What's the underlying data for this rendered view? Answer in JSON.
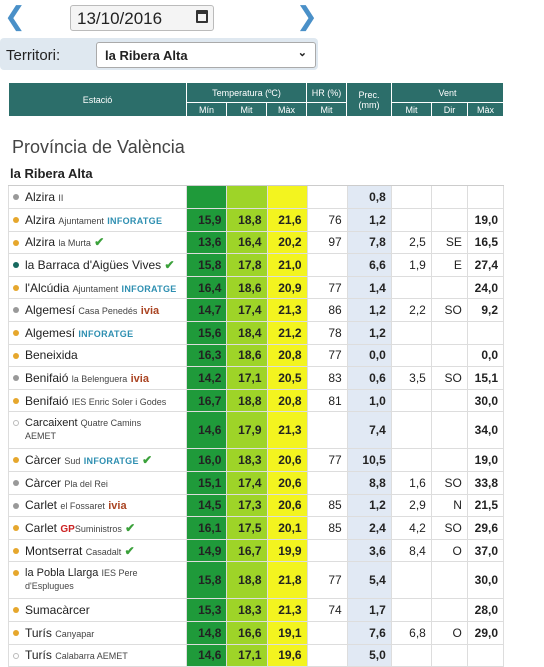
{
  "nav": {
    "prev": "❮",
    "next": "❯",
    "date": "13/10/2016"
  },
  "territori": {
    "label": "Territori:",
    "value": "la Ribera Alta"
  },
  "header": {
    "estacio": "Estació",
    "temperatura": "Temperatura (ºC)",
    "hr": "HR (%)",
    "prec": "Prec. (mm)",
    "vent": "Vent",
    "min": "Mín",
    "mit": "Mit",
    "max": "Màx",
    "hr_mit": "Mit",
    "v_mit": "Mit",
    "v_dir": "Dir",
    "v_max": "Màx"
  },
  "province": "Província de València",
  "region": "la Ribera Alta",
  "rows": [
    {
      "name": "Alzira",
      "sub": "II",
      "dot": "grey",
      "min": "",
      "mit": "",
      "max": "",
      "hr": "",
      "prec": "0,8",
      "vmit": "",
      "vdir": "",
      "vmax": ""
    },
    {
      "name": "Alzira",
      "sub": "Ajuntament",
      "brand": "INFORATGE",
      "dot": "orange",
      "min": "15,9",
      "mit": "18,8",
      "max": "21,6",
      "hr": "76",
      "prec": "1,2",
      "vmit": "",
      "vdir": "",
      "vmax": "19,0"
    },
    {
      "name": "Alzira",
      "sub": "la Murta",
      "tick": "✔",
      "dot": "orange",
      "min": "13,6",
      "mit": "16,4",
      "max": "20,2",
      "hr": "97",
      "prec": "7,8",
      "vmit": "2,5",
      "vdir": "SE",
      "vmax": "16,5"
    },
    {
      "name": "la Barraca d'Aigües Vives",
      "tick": "✔",
      "dot": "teal",
      "min": "15,8",
      "mit": "17,8",
      "max": "21,0",
      "hr": "",
      "prec": "6,6",
      "vmit": "1,9",
      "vdir": "E",
      "vmax": "27,4"
    },
    {
      "name": "l'Alcúdia",
      "sub": "Ajuntament",
      "brand": "INFORATGE",
      "dot": "orange",
      "min": "16,4",
      "mit": "18,6",
      "max": "20,9",
      "hr": "77",
      "prec": "1,4",
      "vmit": "",
      "vdir": "",
      "vmax": "24,0"
    },
    {
      "name": "Algemesí",
      "sub": "Casa Penedés",
      "ivia": "ivia",
      "dot": "grey",
      "min": "14,7",
      "mit": "17,4",
      "max": "21,3",
      "hr": "86",
      "prec": "1,2",
      "vmit": "2,2",
      "vdir": "SO",
      "vmax": "9,2"
    },
    {
      "name": "Algemesí",
      "brand": "INFORATGE",
      "dot": "orange",
      "min": "15,6",
      "mit": "18,4",
      "max": "21,2",
      "hr": "78",
      "prec": "1,2",
      "vmit": "",
      "vdir": "",
      "vmax": ""
    },
    {
      "name": "Beneixida",
      "dot": "orange",
      "min": "16,3",
      "mit": "18,6",
      "max": "20,8",
      "hr": "77",
      "prec": "0,0",
      "vmit": "",
      "vdir": "",
      "vmax": "0,0"
    },
    {
      "name": "Benifaió",
      "sub": "la Belenguera",
      "ivia": "ivia",
      "dot": "grey",
      "min": "14,2",
      "mit": "17,1",
      "max": "20,5",
      "hr": "83",
      "prec": "0,6",
      "vmit": "3,5",
      "vdir": "SO",
      "vmax": "15,1"
    },
    {
      "name": "Benifaió",
      "sub": "IES Enric Soler i Godes",
      "dot": "orange",
      "min": "16,7",
      "mit": "18,8",
      "max": "20,8",
      "hr": "81",
      "prec": "1,0",
      "vmit": "",
      "vdir": "",
      "vmax": "30,0"
    },
    {
      "name": "Carcaixent",
      "sub": "Quatre Camins",
      "line2": "AEMET",
      "dot": "white",
      "tall": true,
      "min": "14,6",
      "mit": "17,9",
      "max": "21,3",
      "hr": "",
      "prec": "7,4",
      "vmit": "",
      "vdir": "",
      "vmax": "34,0"
    },
    {
      "name": "Càrcer",
      "sub": "Sud",
      "brand": "INFORATGE",
      "tick": "✔",
      "dot": "orange",
      "min": "16,0",
      "mit": "18,3",
      "max": "20,6",
      "hr": "77",
      "prec": "10,5",
      "vmit": "",
      "vdir": "",
      "vmax": "19,0"
    },
    {
      "name": "Càrcer",
      "sub": "Pla del Rei",
      "dot": "grey",
      "min": "15,1",
      "mit": "17,4",
      "max": "20,6",
      "hr": "",
      "prec": "8,8",
      "vmit": "1,6",
      "vdir": "SO",
      "vmax": "33,8"
    },
    {
      "name": "Carlet",
      "sub": "el Fossaret",
      "ivia": "ivia",
      "dot": "grey",
      "min": "14,5",
      "mit": "17,3",
      "max": "20,6",
      "hr": "85",
      "prec": "1,2",
      "vmit": "2,9",
      "vdir": "N",
      "vmax": "21,5"
    },
    {
      "name": "Carlet",
      "gp": "GP",
      "sub": "Suministros",
      "tick": "✔",
      "dot": "orange",
      "min": "16,1",
      "mit": "17,5",
      "max": "20,1",
      "hr": "85",
      "prec": "2,4",
      "vmit": "4,2",
      "vdir": "SO",
      "vmax": "29,6"
    },
    {
      "name": "Montserrat",
      "sub": "Casadalt",
      "tick": "✔",
      "dot": "orange",
      "min": "14,9",
      "mit": "16,7",
      "max": "19,9",
      "hr": "",
      "prec": "3,6",
      "vmit": "8,4",
      "vdir": "O",
      "vmax": "37,0"
    },
    {
      "name": "la Pobla Llarga",
      "sub": "IES Pere",
      "line2": "d'Esplugues",
      "dot": "orange",
      "tall": true,
      "min": "15,8",
      "mit": "18,8",
      "max": "21,8",
      "hr": "77",
      "prec": "5,4",
      "vmit": "",
      "vdir": "",
      "vmax": "30,0"
    },
    {
      "name": "Sumacàrcer",
      "dot": "orange",
      "min": "15,3",
      "mit": "18,3",
      "max": "21,3",
      "hr": "74",
      "prec": "1,7",
      "vmit": "",
      "vdir": "",
      "vmax": "28,0"
    },
    {
      "name": "Turís",
      "sub": "Canyapar",
      "dot": "orange",
      "min": "14,8",
      "mit": "16,6",
      "max": "19,1",
      "hr": "",
      "prec": "7,6",
      "vmit": "6,8",
      "vdir": "O",
      "vmax": "29,0"
    },
    {
      "name": "Turís",
      "sub": "Calabarra AEMET",
      "dot": "white",
      "min": "14,6",
      "mit": "17,1",
      "max": "19,6",
      "hr": "",
      "prec": "5,0",
      "vmit": "",
      "vdir": "",
      "vmax": ""
    }
  ]
}
